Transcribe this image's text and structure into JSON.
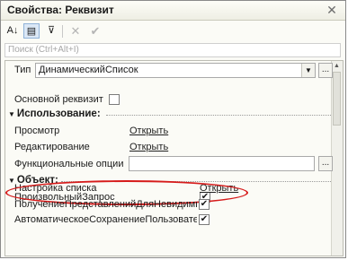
{
  "window": {
    "title": "Свойства: Реквизит",
    "close_glyph": "✕"
  },
  "toolbar": {
    "sort_glyph": "A↓",
    "categories_glyph": "▤",
    "filter_glyph": "⊽",
    "delete_glyph": "✕",
    "apply_glyph": "✔"
  },
  "search": {
    "placeholder": "Поиск (Ctrl+Alt+I)"
  },
  "props": {
    "type_label": "Тип",
    "type_value": "ДинамическийСписок",
    "type_dropdown_glyph": "▼",
    "type_button_glyph": "...",
    "main_label": "Основной реквизит",
    "main_checked": false,
    "usage_title": "Использование:",
    "view_label": "Просмотр",
    "view_link": "Открыть",
    "edit_label": "Редактирование",
    "edit_link": "Открыть",
    "options_label": "Функциональные опции",
    "options_button_glyph": "...",
    "object_title": "Объект:",
    "arbitrary_label": "ПроизвольныйЗапрос",
    "arbitrary_checked": true,
    "list_settings_label": "Настройка списка",
    "list_settings_link": "Открыть",
    "invisible_label": "ПолучениеПредставленийДляНевидимых",
    "invisible_checked": true,
    "autosave_label": "АвтоматическоеСохранениеПользователь",
    "autosave_checked": true,
    "check_glyph": "✔"
  },
  "colors": {
    "highlight": "#d61b1b"
  }
}
